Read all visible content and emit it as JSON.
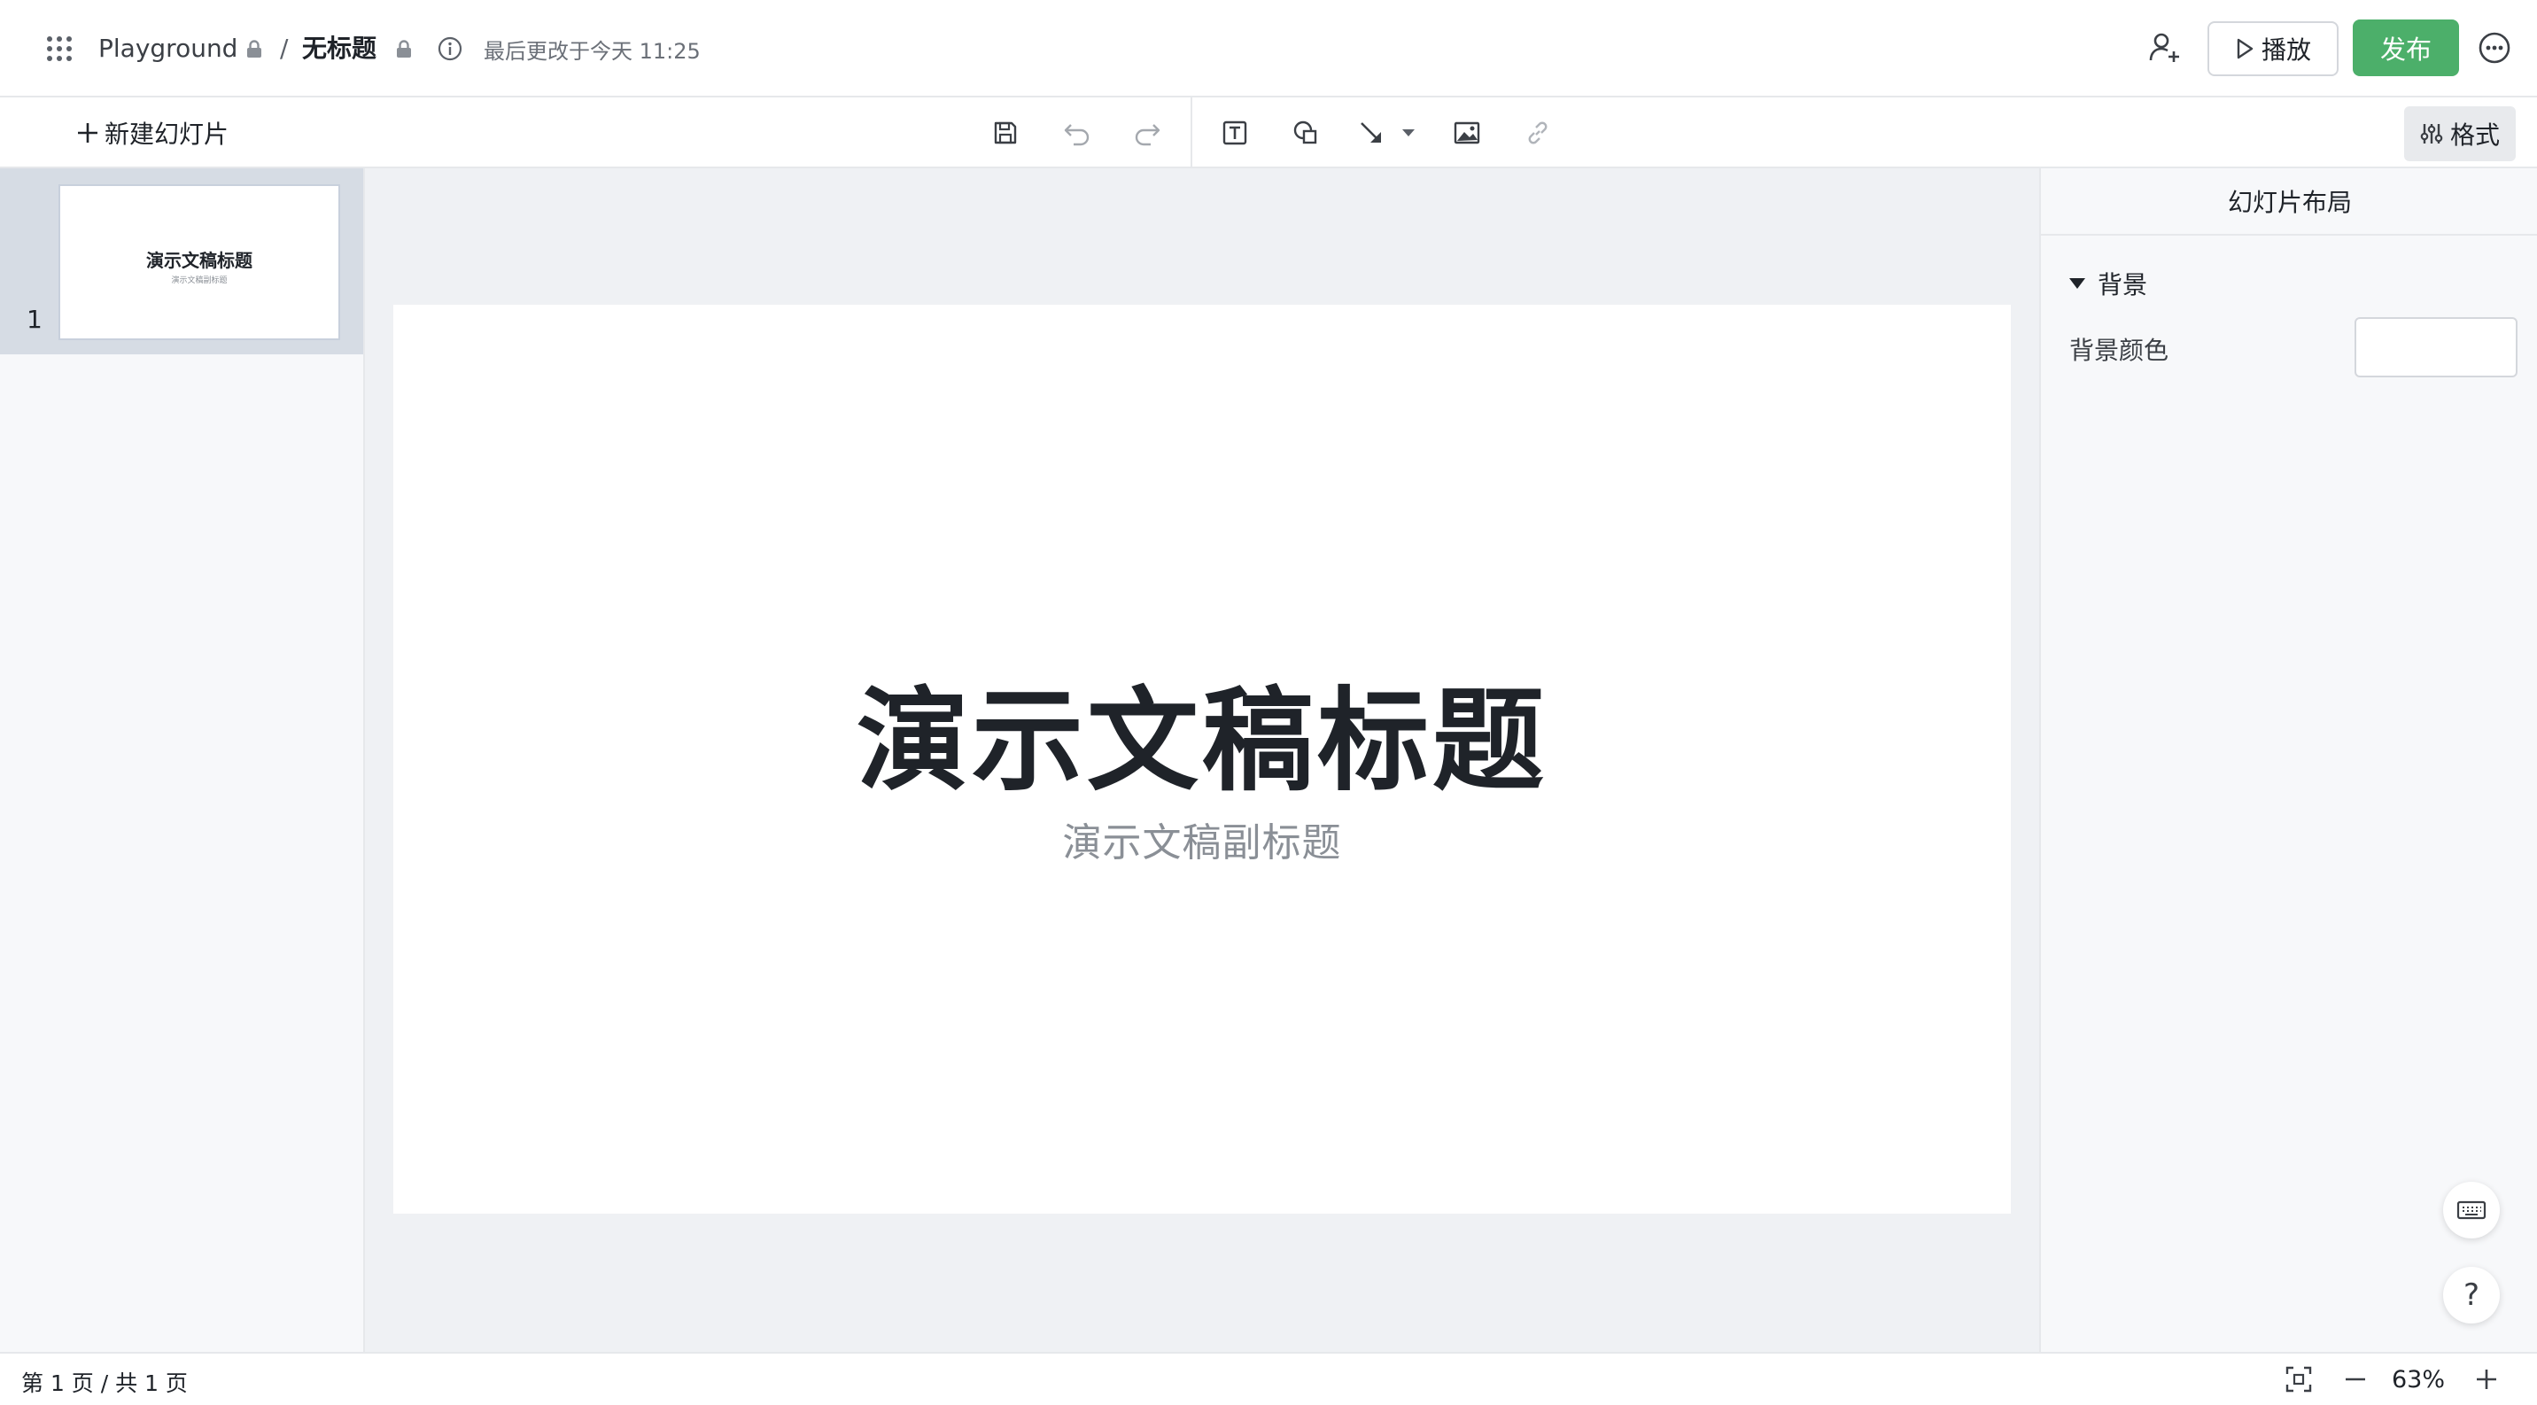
{
  "header": {
    "workspace": "Playground",
    "separator": "/",
    "doc_title": "无标题",
    "last_modified": "最后更改于今天 11:25",
    "play_label": "播放",
    "publish_label": "发布",
    "accent_color": "#4caf6a"
  },
  "toolbar": {
    "new_slide_label": "新建幻灯片",
    "format_label": "格式",
    "tools": [
      "save-icon",
      "undo-icon",
      "redo-icon",
      "text-box-icon",
      "shape-icon",
      "line-icon",
      "image-icon",
      "link-icon"
    ]
  },
  "slides": {
    "items": [
      {
        "number": "1",
        "title": "演示文稿标题",
        "subtitle": "演示文稿副标题"
      }
    ]
  },
  "canvas": {
    "title": "演示文稿标题",
    "subtitle": "演示文稿副标题"
  },
  "panel": {
    "header": "幻灯片布局",
    "section_background": "背景",
    "bg_color_label": "背景颜色",
    "bg_color_value": "#ffffff"
  },
  "status": {
    "page_info": "第 1 页 / 共 1 页",
    "zoom": "63%"
  },
  "help": {
    "label": "?"
  }
}
